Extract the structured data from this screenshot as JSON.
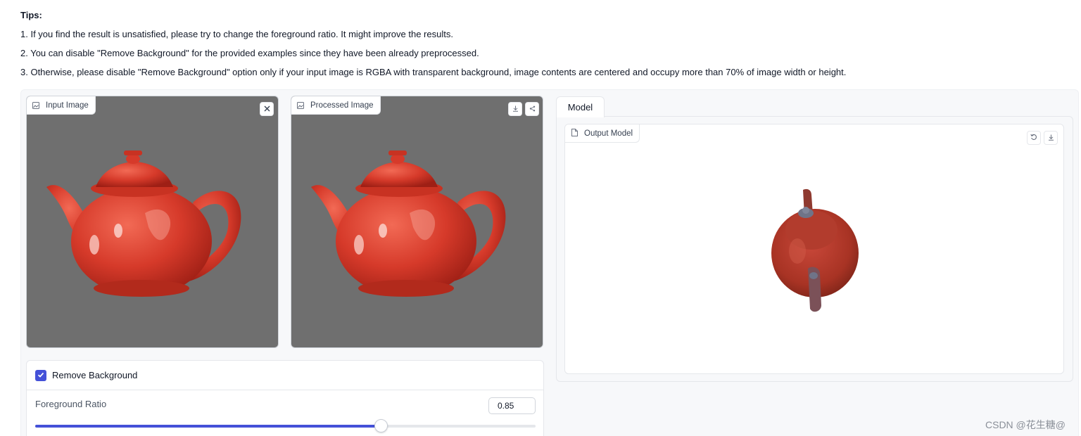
{
  "tips": {
    "title": "Tips:",
    "items": [
      "1. If you find the result is unsatisfied, please try to change the foreground ratio. It might improve the results.",
      "2. You can disable \"Remove Background\" for the provided examples since they have been already preprocessed.",
      "3. Otherwise, please disable \"Remove Background\" option only if your input image is RGBA with transparent background, image contents are centered and occupy more than 70% of image width or height."
    ]
  },
  "input_image": {
    "label": "Input Image",
    "icon": "image-icon",
    "close_icon": "close-icon"
  },
  "processed_image": {
    "label": "Processed Image",
    "icon": "image-icon",
    "download_icon": "download-icon",
    "share_icon": "share-icon"
  },
  "model_tab": {
    "label": "Model"
  },
  "output_model": {
    "label": "Output Model",
    "icon": "file-icon",
    "reset_icon": "reset-view-icon",
    "download_icon": "download-icon"
  },
  "controls": {
    "remove_background": {
      "label": "Remove Background",
      "checked": true
    },
    "foreground_ratio": {
      "label": "Foreground Ratio",
      "value": "0.85",
      "fraction": 0.69
    }
  },
  "watermark": "CSDN @花生糖@",
  "colors": {
    "accent": "#4451d8",
    "image_bg": "#6f6f6f",
    "teapot_red": "#d43c2c"
  }
}
